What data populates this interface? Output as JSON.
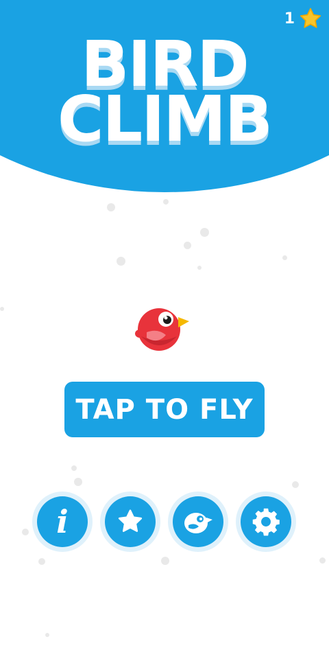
{
  "game": {
    "title_line1": "BIRD",
    "title_line2": "CLIMB"
  },
  "hud": {
    "star_count": "1",
    "star_icon": "star-icon"
  },
  "main": {
    "tap_button_label": "TAP TO FLY",
    "character_icon": "red-bird"
  },
  "menu": {
    "items": [
      {
        "name": "info",
        "icon": "info-icon"
      },
      {
        "name": "rate",
        "icon": "star-icon"
      },
      {
        "name": "birds",
        "icon": "bird-icon"
      },
      {
        "name": "settings",
        "icon": "gear-icon"
      }
    ]
  },
  "colors": {
    "primary_blue": "#1aa2e3",
    "button_ring": "#dff1fb",
    "bird_red": "#e8333b",
    "beak_yellow": "#f5b800",
    "star_gold": "#f7c52b",
    "background": "#ffffff"
  }
}
